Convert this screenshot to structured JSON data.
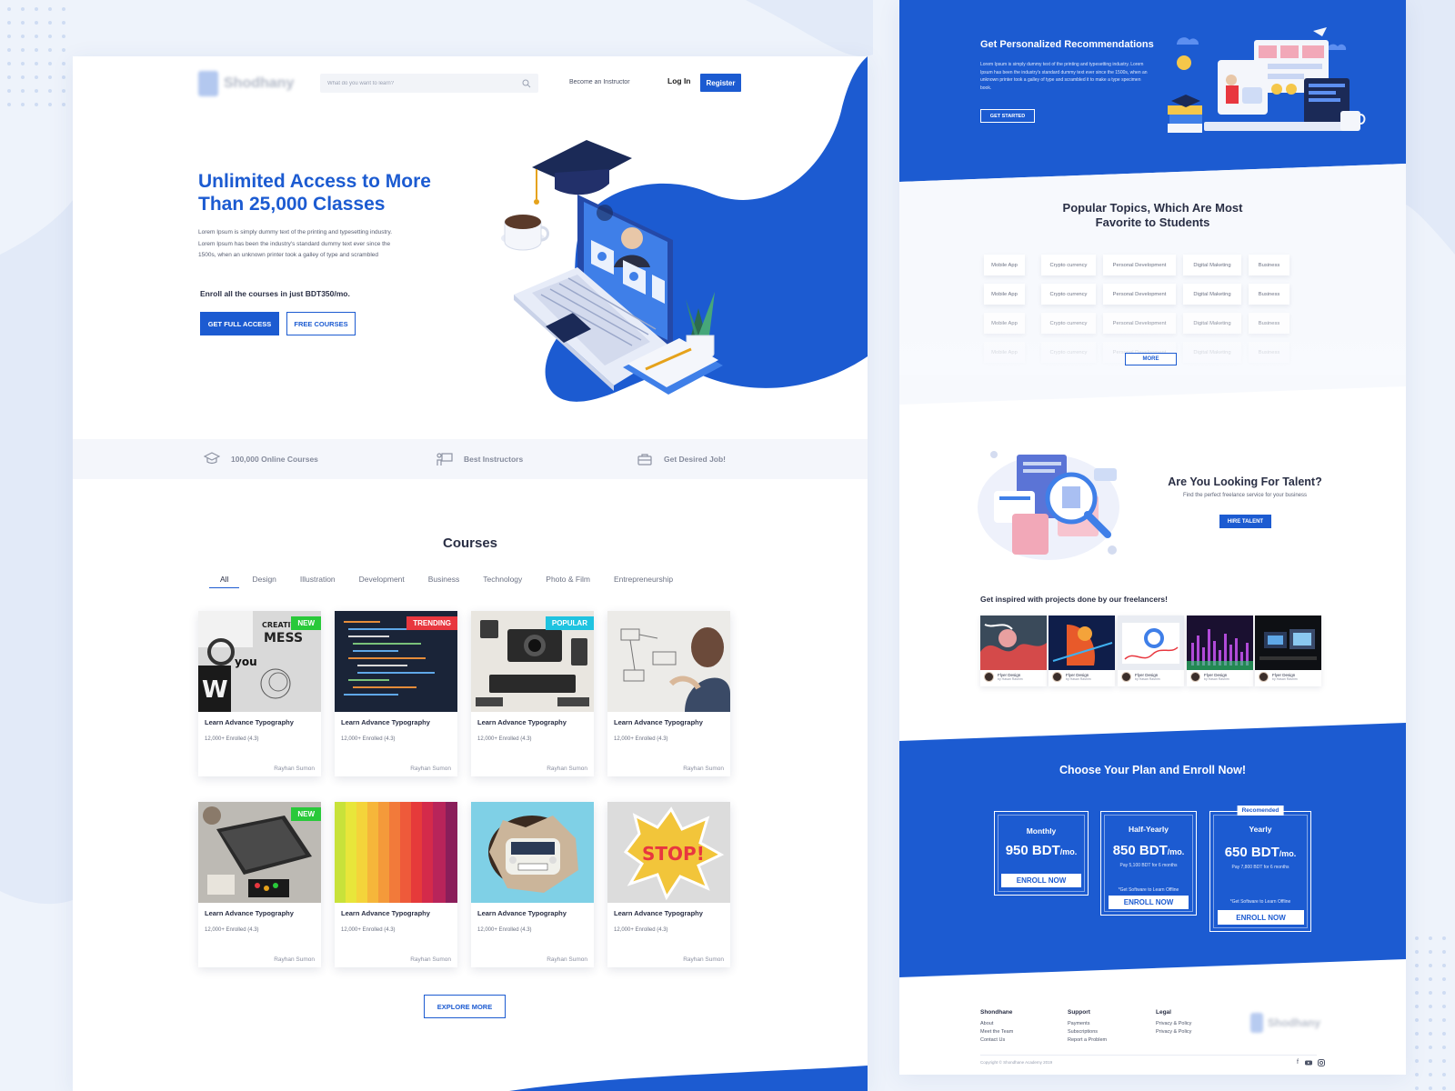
{
  "brand": {
    "name": "Shodhany"
  },
  "nav": {
    "search_placeholder": "What do you want to learn?",
    "become_instructor": "Become an Instructor",
    "login": "Log In",
    "register": "Register"
  },
  "hero": {
    "title": "Unlimited Access to More Than 25,000 Classes",
    "description": "Lorem Ipsum is simply dummy text of the printing and typesetting industry. Lorem Ipsum has been the industry's standard dummy text ever since the 1500s, when an unknown printer took a galley of type and scrambled",
    "enroll_text": "Enroll all the courses in just BDT350/mo.",
    "primary_button": "GET FULL ACCESS",
    "secondary_button": "FREE COURSES"
  },
  "features": [
    {
      "label": "100,000 Online Courses",
      "icon": "graduation-cap-icon"
    },
    {
      "label": "Best Instructors",
      "icon": "instructor-icon"
    },
    {
      "label": "Get Desired Job!",
      "icon": "briefcase-icon"
    }
  ],
  "courses": {
    "title": "Courses",
    "tabs": [
      "All",
      "Design",
      "Illustration",
      "Development",
      "Business",
      "Technology",
      "Photo & Film",
      "Entrepreneurship"
    ],
    "active_tab": "All",
    "items": [
      {
        "title": "Learn Advance Typography",
        "meta": "12,000+ Enrolled (4.3)",
        "author": "Rayhan Sumon",
        "badge": "NEW",
        "badge_color": "#29c93a",
        "image": "typography-collage"
      },
      {
        "title": "Learn Advance Typography",
        "meta": "12,000+ Enrolled (4.3)",
        "author": "Rayhan Sumon",
        "badge": "TRENDING",
        "badge_color": "#e8373f",
        "image": "code-screen"
      },
      {
        "title": "Learn Advance Typography",
        "meta": "12,000+ Enrolled (4.3)",
        "author": "Rayhan Sumon",
        "badge": "POPULAR",
        "badge_color": "#1fc3e0",
        "image": "camera-flatlay"
      },
      {
        "title": "Learn Advance Typography",
        "meta": "12,000+ Enrolled (4.3)",
        "author": "Rayhan Sumon",
        "badge": "",
        "badge_color": "",
        "image": "whiteboard-person"
      },
      {
        "title": "Learn Advance Typography",
        "meta": "12,000+ Enrolled (4.3)",
        "author": "Rayhan Sumon",
        "badge": "NEW",
        "badge_color": "#29c93a",
        "image": "laptop-desk"
      },
      {
        "title": "Learn Advance Typography",
        "meta": "12,000+ Enrolled (4.3)",
        "author": "Rayhan Sumon",
        "badge": "",
        "badge_color": "",
        "image": "color-swatches"
      },
      {
        "title": "Learn Advance Typography",
        "meta": "12,000+ Enrolled (4.3)",
        "author": "Rayhan Sumon",
        "badge": "",
        "badge_color": "",
        "image": "car-wall"
      },
      {
        "title": "Learn Advance Typography",
        "meta": "12,000+ Enrolled (4.3)",
        "author": "Rayhan Sumon",
        "badge": "",
        "badge_color": "",
        "image": "stop-sticker"
      }
    ],
    "explore_button": "EXPLORE MORE"
  },
  "recommendations": {
    "title": "Get Personalized Recommendations",
    "description": "Lorem Ipsum is simply dummy text of the printing and typesetting industry. Lorem Ipsum has been the industry's standard dummy text ever since the 1500s, when an unknown printer took a galley of type and scrambled it to make a type specimen book.",
    "button": "GET STARTED"
  },
  "topics": {
    "title_line1": "Popular Topics, Which Are Most",
    "title_line2": "Favorite to Students",
    "chips": [
      "Mobile App",
      "Crypto currency",
      "Personal Development",
      "Digital Maketing",
      "Business"
    ],
    "rows": 4,
    "more_button": "MORE"
  },
  "talent": {
    "title": "Are You Looking For Talent?",
    "subtitle": "Find the perfect freelance service for your business",
    "button": "HIRE TALENT",
    "inspired_title": "Get inspired with projects done by our freelancers!",
    "projects": [
      {
        "name": "Flyer Design",
        "by": "by Hasan Rashim",
        "theme": "red-art"
      },
      {
        "name": "Flyer Design",
        "by": "by Hasan Rashim",
        "theme": "blue-neon"
      },
      {
        "name": "Flyer Design",
        "by": "by Hasan Rashim",
        "theme": "dashboard"
      },
      {
        "name": "Flyer Design",
        "by": "by Hasan Rashim",
        "theme": "equalizer"
      },
      {
        "name": "Flyer Design",
        "by": "by Hasan Rashim",
        "theme": "monitors"
      }
    ]
  },
  "plans": {
    "title": "Choose Your Plan and Enroll Now!",
    "items": [
      {
        "name": "Monthly",
        "price": "950 BDT",
        "unit": "/mo.",
        "note": "",
        "note2": "",
        "button": "ENROLL NOW",
        "ribbon": ""
      },
      {
        "name": "Half-Yearly",
        "price": "850 BDT",
        "unit": "/mo.",
        "note": "Pay 5,100 BDT for 6 months",
        "note2": "*Get Software to Learn Offline",
        "button": "ENROLL NOW",
        "ribbon": ""
      },
      {
        "name": "Yearly",
        "price": "650 BDT",
        "unit": "/mo.",
        "note": "Pay 7,800 BDT for 6 months",
        "note2": "*Get Software to Learn Offline",
        "button": "ENROLL NOW",
        "ribbon": "Recomended"
      }
    ]
  },
  "footer": {
    "columns": [
      {
        "title": "Shondhane",
        "links": [
          "About",
          "Meet the Team",
          "Contact Us"
        ]
      },
      {
        "title": "Support",
        "links": [
          "Payments",
          "Subscriptions",
          "Report a Problem"
        ]
      },
      {
        "title": "Legal",
        "links": [
          "Privacy & Policy",
          "Privacy & Policy"
        ]
      }
    ],
    "copyright": "Copyright © Shondhane Academy 2019",
    "social": [
      "facebook-icon",
      "youtube-icon",
      "instagram-icon"
    ]
  },
  "colors": {
    "brand_blue": "#1c5bd1",
    "dark_text": "#2a2f45",
    "badge_new": "#29c93a",
    "badge_trending": "#e8373f",
    "badge_popular": "#1fc3e0"
  }
}
